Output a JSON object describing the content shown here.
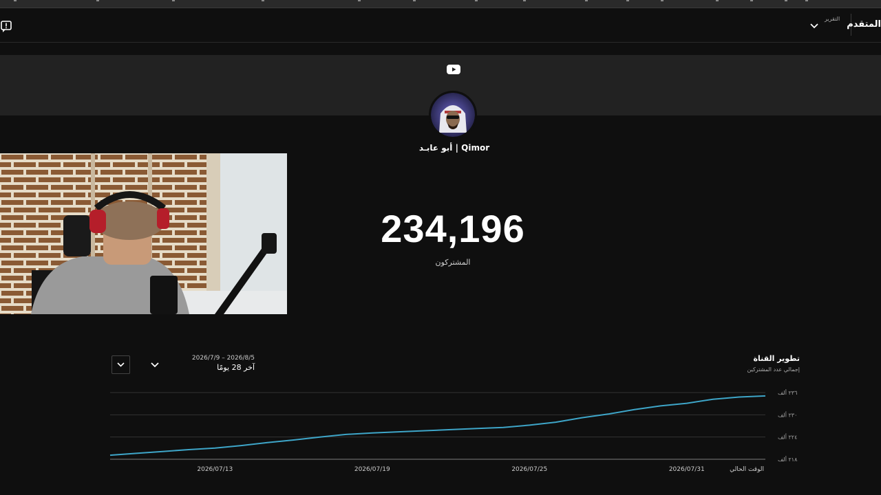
{
  "header": {
    "title": "المتقدم",
    "period_small": "التقرير"
  },
  "channel": {
    "name": "أبو عابـد | Qimor",
    "subscribers": "234,196",
    "subscribers_label": "المشتركون"
  },
  "chart_section": {
    "title": "تطوير القناة",
    "subtitle": "إجمالي عدد المشتركين",
    "date_range": "2026/7/9 – 2026/8/5",
    "date_label": "آخر 28 يومًا"
  },
  "colors": {
    "line": "#3ea6c9",
    "background": "#0f0f0f",
    "banner": "#222222"
  },
  "icons": [
    "feedback-icon",
    "chevron-down-icon",
    "youtube-logo-icon"
  ],
  "chart_data": {
    "type": "line",
    "title": "تطوير القناة",
    "subtitle": "إجمالي عدد المشتركين",
    "x_tick_labels": [
      "2026/07/13",
      "2026/07/19",
      "2026/07/25",
      "2026/07/31",
      "الوقت الحالي"
    ],
    "y_tick_labels": [
      "٢١٨ ألف",
      "٢٢٤ ألف",
      "٢٣٠ ألف",
      "٢٣٦ ألف"
    ],
    "ylim": [
      218000,
      236000
    ],
    "grid": true,
    "series": [
      {
        "values": [
          [
            0,
            219100
          ],
          [
            1,
            219600
          ],
          [
            2,
            220100
          ],
          [
            3,
            220600
          ],
          [
            4,
            221000
          ],
          [
            5,
            221700
          ],
          [
            6,
            222500
          ],
          [
            7,
            223200
          ],
          [
            8,
            224000
          ],
          [
            9,
            224700
          ],
          [
            10,
            225100
          ],
          [
            11,
            225400
          ],
          [
            12,
            225700
          ],
          [
            13,
            226000
          ],
          [
            14,
            226300
          ],
          [
            15,
            226600
          ],
          [
            16,
            227200
          ],
          [
            17,
            228000
          ],
          [
            18,
            229200
          ],
          [
            19,
            230200
          ],
          [
            20,
            231400
          ],
          [
            21,
            232400
          ],
          [
            22,
            233100
          ],
          [
            23,
            234200
          ],
          [
            24,
            234800
          ],
          [
            25,
            235100
          ]
        ]
      }
    ]
  }
}
